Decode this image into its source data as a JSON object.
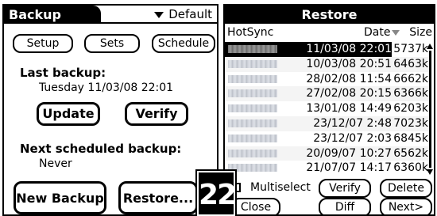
{
  "backup": {
    "tab_title": "Backup",
    "dropdown_value": "Default",
    "buttons": {
      "setup": "Setup",
      "sets": "Sets",
      "schedule": "Schedule",
      "update": "Update",
      "verify": "Verify",
      "new_backup": "New Backup",
      "restore": "Restore..."
    },
    "last_backup_label": "Last backup:",
    "last_backup_value": "Tuesday 11/03/08 22:01",
    "next_scheduled_label": "Next scheduled backup:",
    "next_scheduled_value": "Never"
  },
  "restore": {
    "title": "Restore",
    "columns": {
      "hotsync": "HotSync",
      "date": "Date",
      "size": "Size"
    },
    "rows": [
      {
        "date": "11/03/08 22:01",
        "size": "5737k",
        "selected": true
      },
      {
        "date": "10/03/08 20:51",
        "size": "6463k",
        "selected": false
      },
      {
        "date": "28/02/08 11:54",
        "size": "6662k",
        "selected": false
      },
      {
        "date": "27/02/08 20:15",
        "size": "6366k",
        "selected": false
      },
      {
        "date": "13/01/08 14:49",
        "size": "6203k",
        "selected": false
      },
      {
        "date": "23/12/07 2:48",
        "size": "7023k",
        "selected": false
      },
      {
        "date": "23/12/07 2:03",
        "size": "6845k",
        "selected": false
      },
      {
        "date": "20/09/07 10:27",
        "size": "6562k",
        "selected": false
      },
      {
        "date": "21/07/07 14:17",
        "size": "6360k",
        "selected": false
      }
    ],
    "multiselect_label": "Multiselect",
    "multiselect_checked": false,
    "buttons": {
      "verify": "Verify",
      "delete": "Delete",
      "close": "Close",
      "diff": "Diff",
      "next": "Next>"
    }
  },
  "figure_badge": "22"
}
